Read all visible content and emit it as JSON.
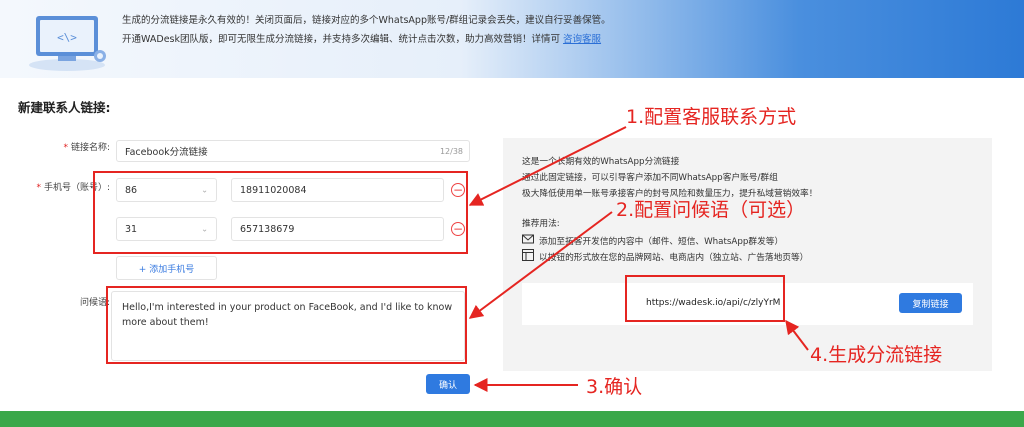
{
  "banner": {
    "line1": "生成的分流链接是永久有效的！关闭页面后，链接对应的多个WhatsApp账号/群组记录会丢失，建议自行妥善保管。",
    "line2": "开通WADesk团队版，即可无限生成分流链接，并支持多次编辑、统计点击次数，助力高效营销！详情可",
    "link": "咨询客服"
  },
  "page_title": "新建联系人链接:",
  "form": {
    "link_name_label": "链接名称:",
    "link_name_value": "Facebook分流链接",
    "link_name_counter": "12/38",
    "phone_label": "手机号（账号）:",
    "phones": [
      {
        "code": "86",
        "number": "18911020084"
      },
      {
        "code": "31",
        "number": "657138679"
      }
    ],
    "add_phone": "+ 添加手机号",
    "greeting_label": "问候语:",
    "greeting_value": "Hello,I'm interested in your product on FaceBook, and I'd like to know more about them!",
    "confirm": "确认"
  },
  "panel": {
    "desc1": "这是一个长期有效的WhatsApp分流链接",
    "desc2": "通过此固定链接，可以引导客户添加不同WhatsApp客户账号/群组",
    "desc3": "极大降低使用单一账号承接客户的封号风险和数量压力，提升私域营销效率！",
    "usage_title": "推荐用法:",
    "usage1": "添加至拓客开发信的内容中（邮件、短信、WhatsApp群发等）",
    "usage2": "以按钮的形式放在您的品牌网站、电商店内（独立站、广告落地页等）",
    "link": "https://wadesk.io/api/c/zlyYrM",
    "copy": "复制链接"
  },
  "annotations": {
    "step1": "1.配置客服联系方式",
    "step2": "2.配置问候语（可选）",
    "step3": "3.确认",
    "step4": "4.生成分流链接"
  },
  "colors": {
    "accent": "#2f7ae0",
    "annotation": "#e52521",
    "footer": "#3aa84a"
  }
}
